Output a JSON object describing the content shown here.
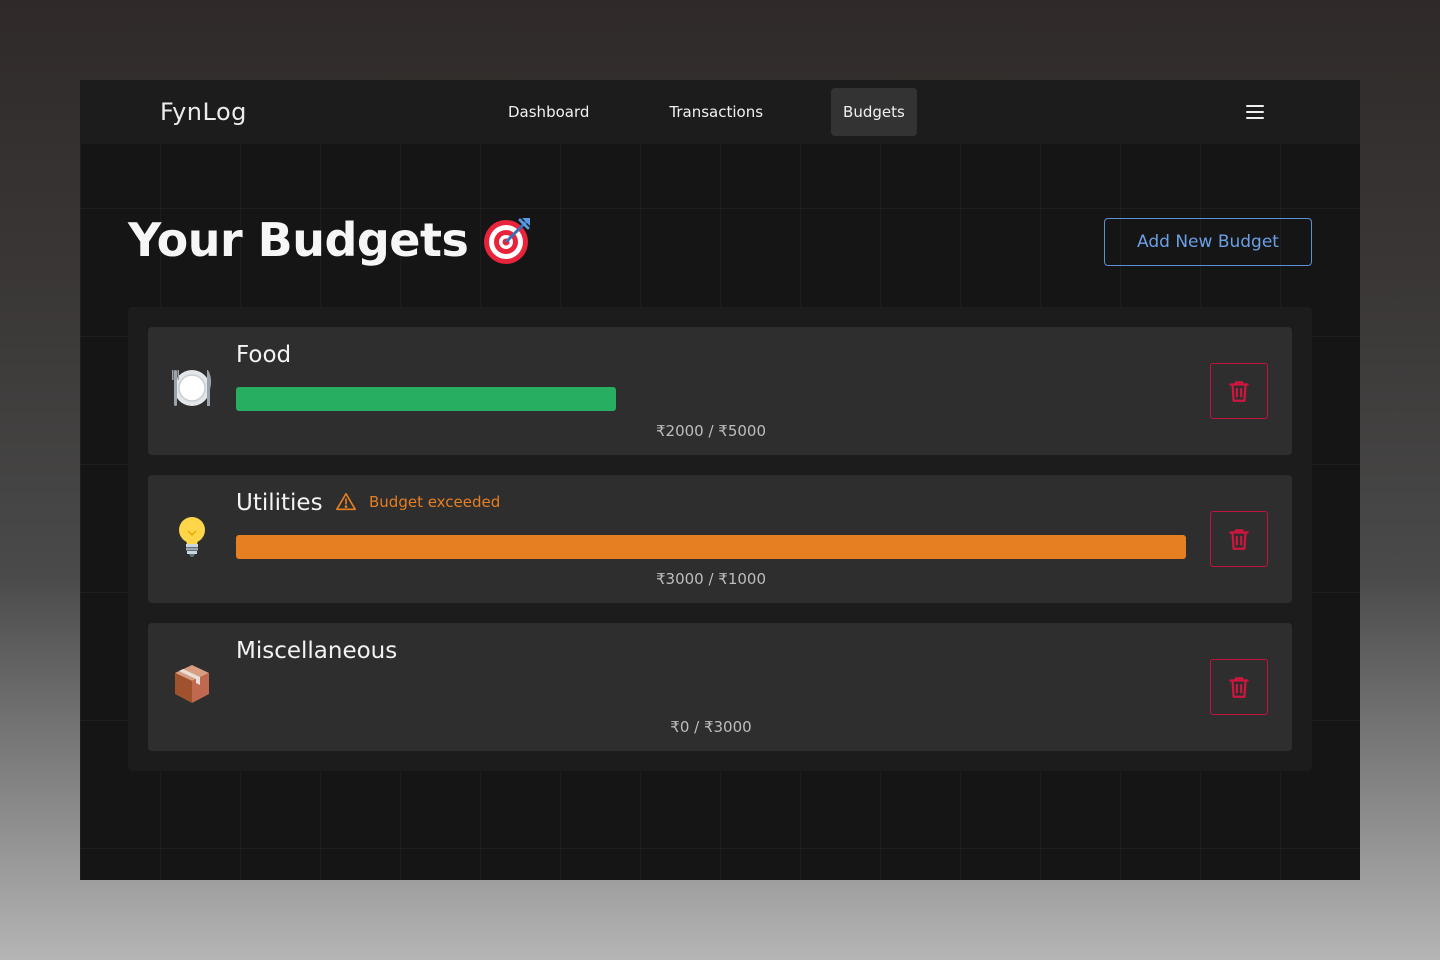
{
  "brand": "FynLog",
  "nav": {
    "links": [
      {
        "label": "Dashboard",
        "active": false
      },
      {
        "label": "Transactions",
        "active": false
      },
      {
        "label": "Budgets",
        "active": true
      }
    ],
    "menu_icon": "hamburger-menu-icon"
  },
  "page": {
    "title": "Your Budgets",
    "title_icon": "target-icon",
    "add_button_label": "Add New Budget"
  },
  "budgets": [
    {
      "name": "Food",
      "icon": "plate-cutlery-icon",
      "spent_text": "₹2000 / ₹5000",
      "spent": 2000,
      "limit": 5000,
      "progress": 0.4,
      "bar_color": "#27ae60",
      "warning": ""
    },
    {
      "name": "Utilities",
      "icon": "light-bulb-icon",
      "spent_text": "₹3000 / ₹1000",
      "spent": 3000,
      "limit": 1000,
      "progress": 1.0,
      "bar_color": "#e67e22",
      "warning": "Budget exceeded"
    },
    {
      "name": "Miscellaneous",
      "icon": "package-box-icon",
      "spent_text": "₹0 / ₹3000",
      "spent": 0,
      "limit": 3000,
      "progress": 0,
      "bar_color": "#27ae60",
      "warning": ""
    }
  ],
  "colors": {
    "accent_blue": "#5b8fd6",
    "danger_red": "#c0143c",
    "warning_orange": "#e67e22",
    "success_green": "#27ae60"
  }
}
